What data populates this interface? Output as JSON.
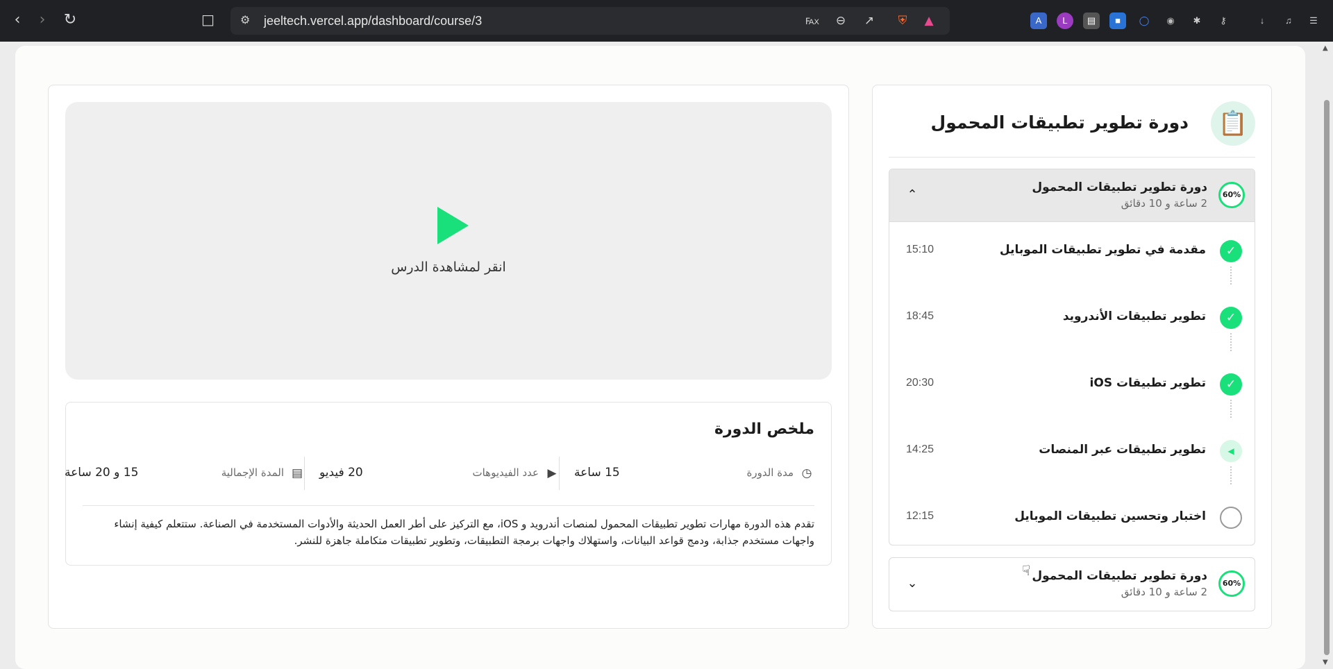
{
  "browser": {
    "url": "jeeltech.vercel.app/dashboard/course/3"
  },
  "colors": {
    "accent": "#19e07a",
    "page_bg": "#fcfcfb",
    "video_bg": "#efeff0"
  },
  "video": {
    "prompt": "انقر لمشاهدة الدرس",
    "icon": "play-icon"
  },
  "summary": {
    "title": "ملخص الدورة",
    "stats": [
      {
        "label": "مدة الدورة",
        "value": "15 ساعة",
        "icon": "clock-icon"
      },
      {
        "label": "عدد الفيديوهات",
        "value": "20 فيديو",
        "icon": "video-icon"
      },
      {
        "label": "المدة الإجمالية",
        "value": "15 و 20 ساعة",
        "icon": "certificate-icon"
      }
    ],
    "description": "تقدم هذه الدورة مهارات تطوير تطبيقات المحمول لمنصات أندرويد و iOS، مع التركيز على أطر العمل الحديثة والأدوات المستخدمة في الصناعة. ستتعلم كيفية إنشاء واجهات مستخدم جذابة، ودمج قواعد البيانات، واستهلاك واجهات برمجة التطبيقات، وتطوير تطبيقات متكاملة جاهزة للنشر."
  },
  "sidebar": {
    "course_title": "دورة تطوير تطبيقات المحمول",
    "sections": [
      {
        "title": "دورة تطوير تطبيقات المحمول",
        "duration": "2 ساعة و 10 دقائق",
        "progress": "60%",
        "progress_value": 60,
        "expanded": true,
        "lessons": [
          {
            "title": "مقدمة في تطوير تطبيقات الموبايل",
            "time": "15:10",
            "status": "done"
          },
          {
            "title": "تطوير تطبيقات الأندرويد",
            "time": "18:45",
            "status": "done"
          },
          {
            "title": "تطوير تطبيقات iOS",
            "time": "20:30",
            "status": "done"
          },
          {
            "title": "تطوير تطبيقات عبر المنصات",
            "time": "14:25",
            "status": "current"
          },
          {
            "title": "اختبار وتحسين تطبيقات الموبايل",
            "time": "12:15",
            "status": "todo"
          }
        ]
      },
      {
        "title": "دورة تطوير تطبيقات المحمول",
        "duration": "2 ساعة و 10 دقائق",
        "progress": "60%",
        "progress_value": 60,
        "expanded": false
      }
    ]
  }
}
